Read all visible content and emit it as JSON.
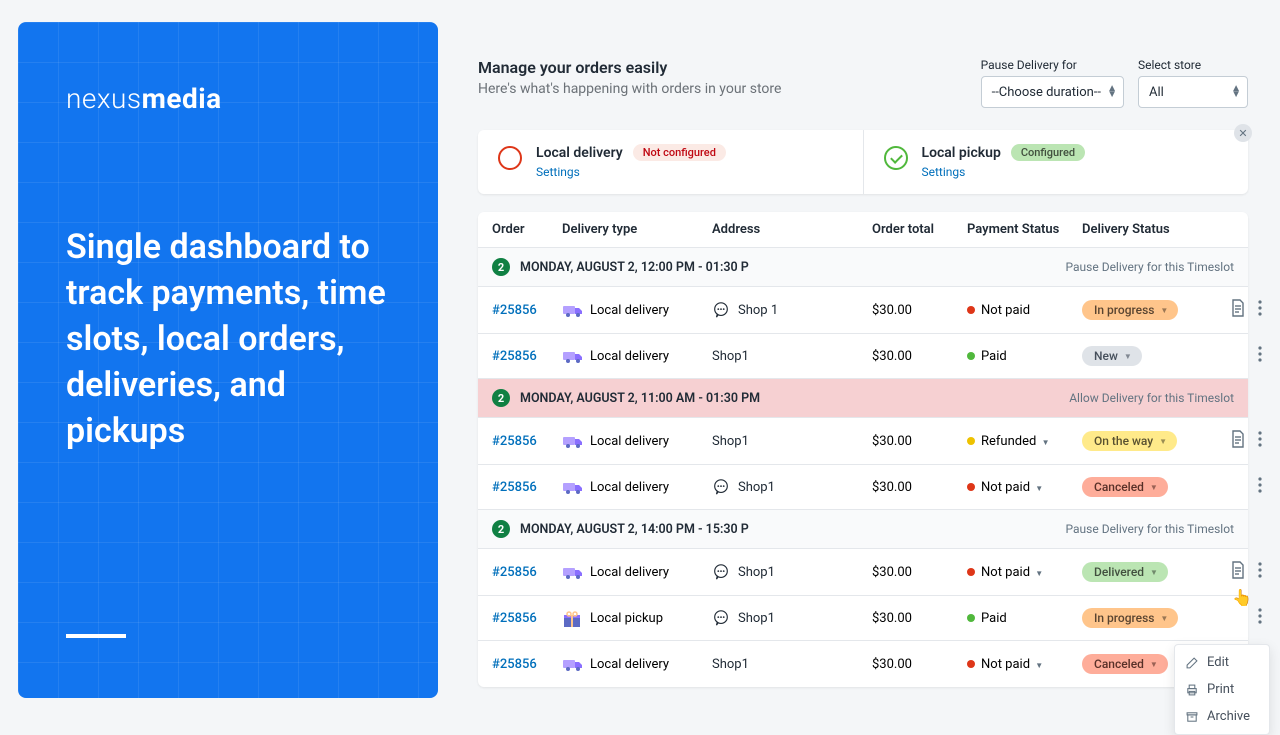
{
  "hero": {
    "logo_a": "nexus",
    "logo_b": "media",
    "tagline": "Single dashboard to track payments, time slots, local orders, deliveries, and pickups"
  },
  "header": {
    "title": "Manage your orders easily",
    "subtitle": "Here's what's happening with orders in your store"
  },
  "controls": {
    "pause_label": "Pause Delivery for",
    "pause_value": "--Choose duration--",
    "store_label": "Select store",
    "store_value": "All"
  },
  "cards": {
    "delivery": {
      "title": "Local delivery",
      "badge": "Not configured",
      "settings": "Settings"
    },
    "pickup": {
      "title": "Local pickup",
      "badge": "Configured",
      "settings": "Settings"
    }
  },
  "columns": {
    "order": "Order",
    "delivery_type": "Delivery type",
    "address": "Address",
    "total": "Order total",
    "payment": "Payment Status",
    "delivery": "Delivery Status"
  },
  "groups": [
    {
      "count": "2",
      "label": "MONDAY, AUGUST 2, 12:00 PM - 01:30 P",
      "action": "Pause Delivery for this Timeslot",
      "paused": false
    },
    {
      "count": "2",
      "label": "MONDAY, AUGUST 2, 11:00 AM - 01:30 PM",
      "action": "Allow Delivery for this Timeslot",
      "paused": true
    },
    {
      "count": "2",
      "label": "MONDAY, AUGUST 2, 14:00 PM - 15:30 P",
      "action": "Pause Delivery for this Timeslot",
      "paused": false
    }
  ],
  "rows": [
    {
      "id": "#25856",
      "type": "Local delivery",
      "type_icon": "truck",
      "addr": "Shop 1",
      "chat": true,
      "total": "$30.00",
      "pay": "Not paid",
      "pay_dot": "red",
      "pay_caret": false,
      "status": "In progress",
      "status_style": "orange",
      "status_caret": true,
      "doc": true,
      "menu": true
    },
    {
      "id": "#25856",
      "type": "Local delivery",
      "type_icon": "truck",
      "addr": "Shop1",
      "chat": false,
      "total": "$30.00",
      "pay": "Paid",
      "pay_dot": "green",
      "pay_caret": false,
      "status": "New",
      "status_style": "grey",
      "status_caret": true,
      "doc": false,
      "menu": true
    },
    {
      "id": "#25856",
      "type": "Local delivery",
      "type_icon": "truck",
      "addr": "Shop1",
      "chat": false,
      "total": "$30.00",
      "pay": "Refunded",
      "pay_dot": "yellow",
      "pay_caret": true,
      "status": "On the way",
      "status_style": "yellow",
      "status_caret": true,
      "doc": true,
      "menu": true
    },
    {
      "id": "#25856",
      "type": "Local delivery",
      "type_icon": "truck",
      "addr": "Shop1",
      "chat": true,
      "total": "$30.00",
      "pay": "Not paid",
      "pay_dot": "red",
      "pay_caret": true,
      "status": "Canceled",
      "status_style": "redp",
      "status_caret": true,
      "doc": false,
      "menu": true
    },
    {
      "id": "#25856",
      "type": "Local delivery",
      "type_icon": "truck",
      "addr": "Shop1",
      "chat": true,
      "total": "$30.00",
      "pay": "Not paid",
      "pay_dot": "red",
      "pay_caret": true,
      "status": "Delivered",
      "status_style": "greenp",
      "status_caret": true,
      "doc": true,
      "menu": true
    },
    {
      "id": "#25856",
      "type": "Local pickup",
      "type_icon": "gift",
      "addr": "Shop1",
      "chat": true,
      "total": "$30.00",
      "pay": "Paid",
      "pay_dot": "green",
      "pay_caret": false,
      "status": "In progress",
      "status_style": "orange",
      "status_caret": true,
      "doc": false,
      "menu": true
    },
    {
      "id": "#25856",
      "type": "Local delivery",
      "type_icon": "truck",
      "addr": "Shop1",
      "chat": false,
      "total": "$30.00",
      "pay": "Not paid",
      "pay_dot": "red",
      "pay_caret": true,
      "status": "Canceled",
      "status_style": "redp",
      "status_caret": true,
      "doc": true,
      "menu": true
    }
  ],
  "row_groups": [
    0,
    0,
    1,
    1,
    2,
    2,
    2
  ],
  "context_menu": {
    "edit": "Edit",
    "print": "Print",
    "archive": "Archive"
  }
}
